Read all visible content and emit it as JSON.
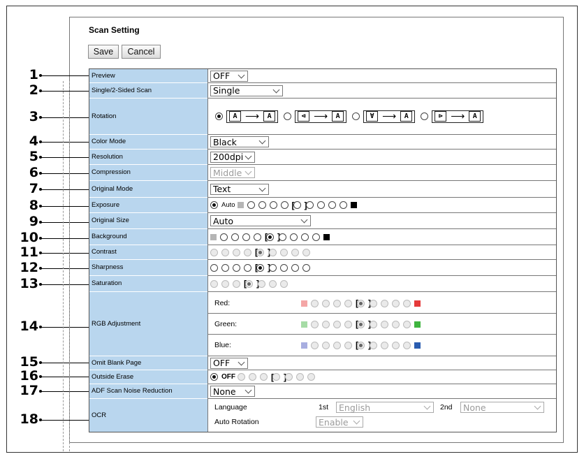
{
  "page": {
    "title": "Scan Setting"
  },
  "toolbar": {
    "save": "Save",
    "cancel": "Cancel"
  },
  "callouts": [
    "1",
    "2",
    "3",
    "4",
    "5",
    "6",
    "7",
    "8",
    "9",
    "10",
    "11",
    "12",
    "13",
    "14",
    "15",
    "16",
    "17",
    "18"
  ],
  "rows": {
    "preview": {
      "label": "Preview",
      "value": "OFF"
    },
    "duplex": {
      "label": "Single/2-Sided Scan",
      "value": "Single"
    },
    "rotation": {
      "label": "Rotation",
      "selected_index": 0,
      "glyphs": [
        [
          "A",
          "A"
        ],
        [
          "⊲",
          "A"
        ],
        [
          "∀",
          "A"
        ],
        [
          "⊳",
          "A"
        ]
      ]
    },
    "color": {
      "label": "Color Mode",
      "value": "Black"
    },
    "resolution": {
      "label": "Resolution",
      "value": "200dpi"
    },
    "compression": {
      "label": "Compression",
      "value": "Middle",
      "disabled": true
    },
    "original_mode": {
      "label": "Original Mode",
      "value": "Text"
    },
    "exposure": {
      "label": "Exposure",
      "auto_label": "Auto",
      "selected": "Auto"
    },
    "original_size": {
      "label": "Original Size",
      "value": "Auto"
    },
    "background": {
      "label": "Background"
    },
    "contrast": {
      "label": "Contrast"
    },
    "sharpness": {
      "label": "Sharpness"
    },
    "saturation": {
      "label": "Saturation"
    },
    "rgb": {
      "label": "RGB Adjustment",
      "channels": [
        {
          "name": "Red:",
          "low": "#f4a6a6",
          "high": "#e53a3a"
        },
        {
          "name": "Green:",
          "low": "#a6dca6",
          "high": "#3fb43f"
        },
        {
          "name": "Blue:",
          "low": "#a8aee0",
          "high": "#2a5db0"
        }
      ]
    },
    "omit_blank": {
      "label": "Omit Blank Page",
      "value": "OFF"
    },
    "outside_erase": {
      "label": "Outside Erase",
      "off_label": "OFF",
      "selected": "OFF"
    },
    "adf_noise": {
      "label": "ADF Scan Noise Reduction",
      "value": "None"
    },
    "ocr": {
      "label": "OCR",
      "language_label": "Language",
      "first_label": "1st",
      "first_value": "English",
      "second_label": "2nd",
      "second_value": "None",
      "auto_rotation_label": "Auto Rotation",
      "auto_rotation_value": "Enable"
    }
  }
}
